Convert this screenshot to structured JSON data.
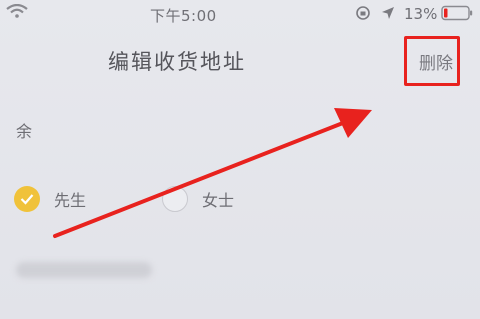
{
  "status_bar": {
    "time": "下午5:00",
    "battery_percent": "13%",
    "icons": [
      "wifi-icon",
      "rotation-lock-icon",
      "location-icon",
      "battery-icon"
    ]
  },
  "header": {
    "title": "编辑收货地址",
    "delete_label": "删除"
  },
  "form": {
    "contact_name": "余",
    "gender": {
      "options": [
        "先生",
        "女士"
      ],
      "selected": "先生"
    }
  },
  "colors": {
    "accent": "#f0c23a",
    "highlight": "#e8221e",
    "background": "#e4e5ea"
  }
}
